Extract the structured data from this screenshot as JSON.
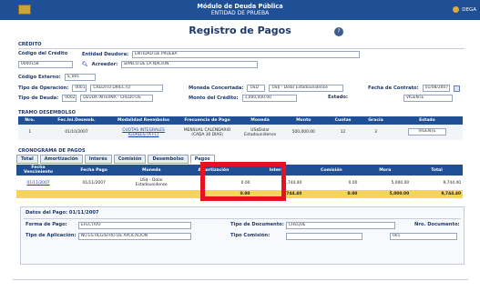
{
  "header": {
    "title": "Módulo de Deuda Pública",
    "subtitle": "ENTIDAD DE PRUEBA",
    "user": "DEGA"
  },
  "page_title": "Registro de Pagos",
  "credito": {
    "section": "CRÉDITO",
    "codigo_label": "Código del Crédito",
    "codigo_value": "0000158",
    "entidad_label": "Entidad Deudora:",
    "entidad_value": "ENTIDAD DE PRUEBA",
    "acreedor_label": "Acreedor:",
    "acreedor_value": "BANCO DE LA NACION",
    "codigo_externo_label": "Código Externo:",
    "codigo_externo_value": "S_001",
    "tipo_operacion_label": "Tipo de Operación:",
    "tipo_operacion_code": "0001",
    "tipo_operacion_value": "CRÉDITO DIRECTO",
    "moneda_label": "Moneda Concertada:",
    "moneda_code": "USD",
    "moneda_value": "US$ - Dolar Estadounidense",
    "fecha_contrato_label": "Fecha de Contrato:",
    "fecha_contrato_value": "01/08/2007",
    "tipo_deuda_label": "Tipo de Deuda:",
    "tipo_deuda_code": "0002",
    "tipo_deuda_value": "DEUDA INTERNA - CREDITOS",
    "monto_label": "Monto del Crédito:",
    "monto_value": "1,000,000.00",
    "estado_label": "Estado:",
    "estado_value": "VIGENTE"
  },
  "tramo": {
    "section": "TRAMO DESEMBOLSO",
    "headers": [
      "Nro.",
      "Fec.Ini.Desemb.",
      "Modalidad Reembolso",
      "Frecuencia de Pago",
      "Moneda",
      "Monto",
      "Cuotas",
      "Gracia",
      "Estado"
    ],
    "row": [
      "1",
      "01/10/2007",
      "CUOTAS INTEGRALES IGUALES (A+C)",
      "MENSUAL CALENDARIO (CADA 30 DIAS)",
      "US$Dolar Estadounidense",
      "500,000.00",
      "12",
      "3",
      "VIGENTE"
    ]
  },
  "cronograma": {
    "section": "CRONOGRAMA DE PAGOS",
    "tabs": [
      "Total",
      "Amortización",
      "Interés",
      "Comisión",
      "Desembolso",
      "Pagos"
    ],
    "headers": [
      "Fecha Vencimiento",
      "Fecha Pago",
      "Moneda",
      "Amortización",
      "Interés",
      "Comisión",
      "Mora",
      "Total"
    ],
    "row": [
      "01/11/2007",
      "01/11/2007",
      "US$ - Dolar Estadounidense",
      "0.00",
      "4,744.40",
      "0.00",
      "5,000.00",
      "9,744.40"
    ],
    "totals": [
      "0.00",
      "4,744.40",
      "0.00",
      "5,000.00",
      "9,744.40"
    ]
  },
  "detalle": {
    "title": "Datos del Pago: 01/11/2007",
    "forma_label": "Forma de Pago:",
    "forma_value": "EFECTIVO",
    "tipo_doc_label": "Tipo de Documento:",
    "tipo_doc_value": "CHEQUE",
    "nro_doc_label": "Nro. Documento:",
    "nro_doc_value": "",
    "aplicacion_label": "Tipo de Aplicación:",
    "aplicacion_value": "NO ES REGISTRO DE APLICACIÓN",
    "tipo_comision_label": "Tipo Comisión:",
    "tipo_comision_value": "",
    "extra_value": "001"
  }
}
